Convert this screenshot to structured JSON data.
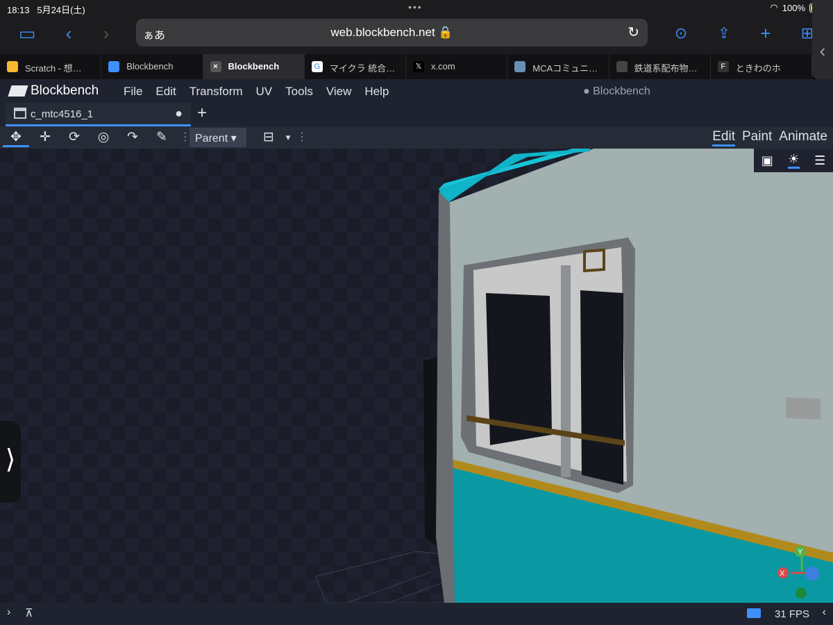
{
  "device_status": {
    "time": "18:13",
    "date": "5月24日(土)",
    "battery": "100%"
  },
  "safari": {
    "url_prefix": "ぁあ",
    "url": "web.blockbench.net",
    "tabs": [
      {
        "label": "Scratch - 想…",
        "icon": "scratch-icon",
        "color": "#f7b733"
      },
      {
        "label": "Blockbench",
        "icon": "blockbench-icon",
        "color": "#3e90ff"
      },
      {
        "label": "Blockbench",
        "icon": "close-icon",
        "color": "#555555",
        "active": true
      },
      {
        "label": "マイクラ 統合…",
        "icon": "google-icon",
        "color": "#ffffff"
      },
      {
        "label": "x.com",
        "icon": "x-icon",
        "color": "#000000"
      },
      {
        "label": "MCAコミュニ…",
        "icon": "mca-icon",
        "color": "#6a8fb8"
      },
      {
        "label": "鉄道系配布物…",
        "icon": "rail-icon",
        "color": "#444444"
      },
      {
        "label": "ときわのホ",
        "icon": "f-icon",
        "color": "#333333"
      }
    ]
  },
  "blockbench": {
    "app_name": "Blockbench",
    "menu": [
      "File",
      "Edit",
      "Transform",
      "UV",
      "Tools",
      "View",
      "Help"
    ],
    "window_title": "● Blockbench",
    "project_tab": "c_mtc4516_1",
    "pivot_mode": "Parent",
    "modes": [
      "Edit",
      "Paint",
      "Animate"
    ],
    "active_mode": "Edit",
    "fps": "31 FPS"
  },
  "axes": {
    "x": "X",
    "y": "Y"
  },
  "colors": {
    "accent": "#3e90ff",
    "teal_body": "#0a9aa3",
    "roof_cyan": "#18c6d8",
    "stripe": "#b08a1c",
    "panel": "#a4b0b0"
  }
}
